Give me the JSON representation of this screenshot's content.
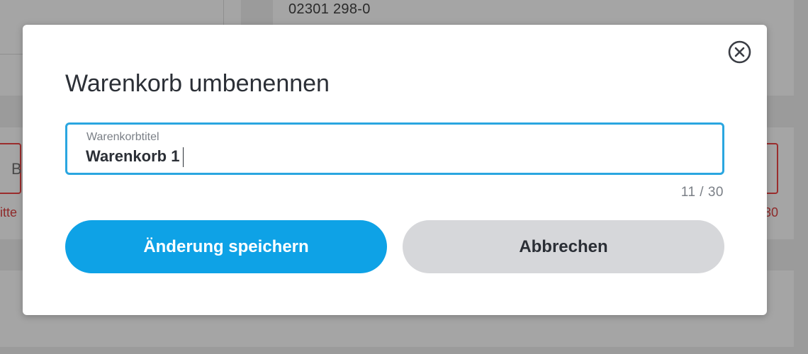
{
  "background": {
    "phone": "02301 298-0",
    "left_field_text": "B",
    "left_error_text": "itte",
    "right_error_text": "30"
  },
  "dialog": {
    "title": "Warenkorb umbenennen",
    "close_icon": "close-circle-icon",
    "field": {
      "label": "Warenkorbtitel",
      "value": "Warenkorb 1",
      "counter": "11 / 30"
    },
    "buttons": {
      "save": "Änderung speichern",
      "cancel": "Abbrechen"
    }
  },
  "colors": {
    "accent": "#0ea2e6",
    "focus_border": "#2aa6e0",
    "cancel_bg": "#d6d7da",
    "text": "#2b2f36",
    "muted": "#7a7f86"
  }
}
